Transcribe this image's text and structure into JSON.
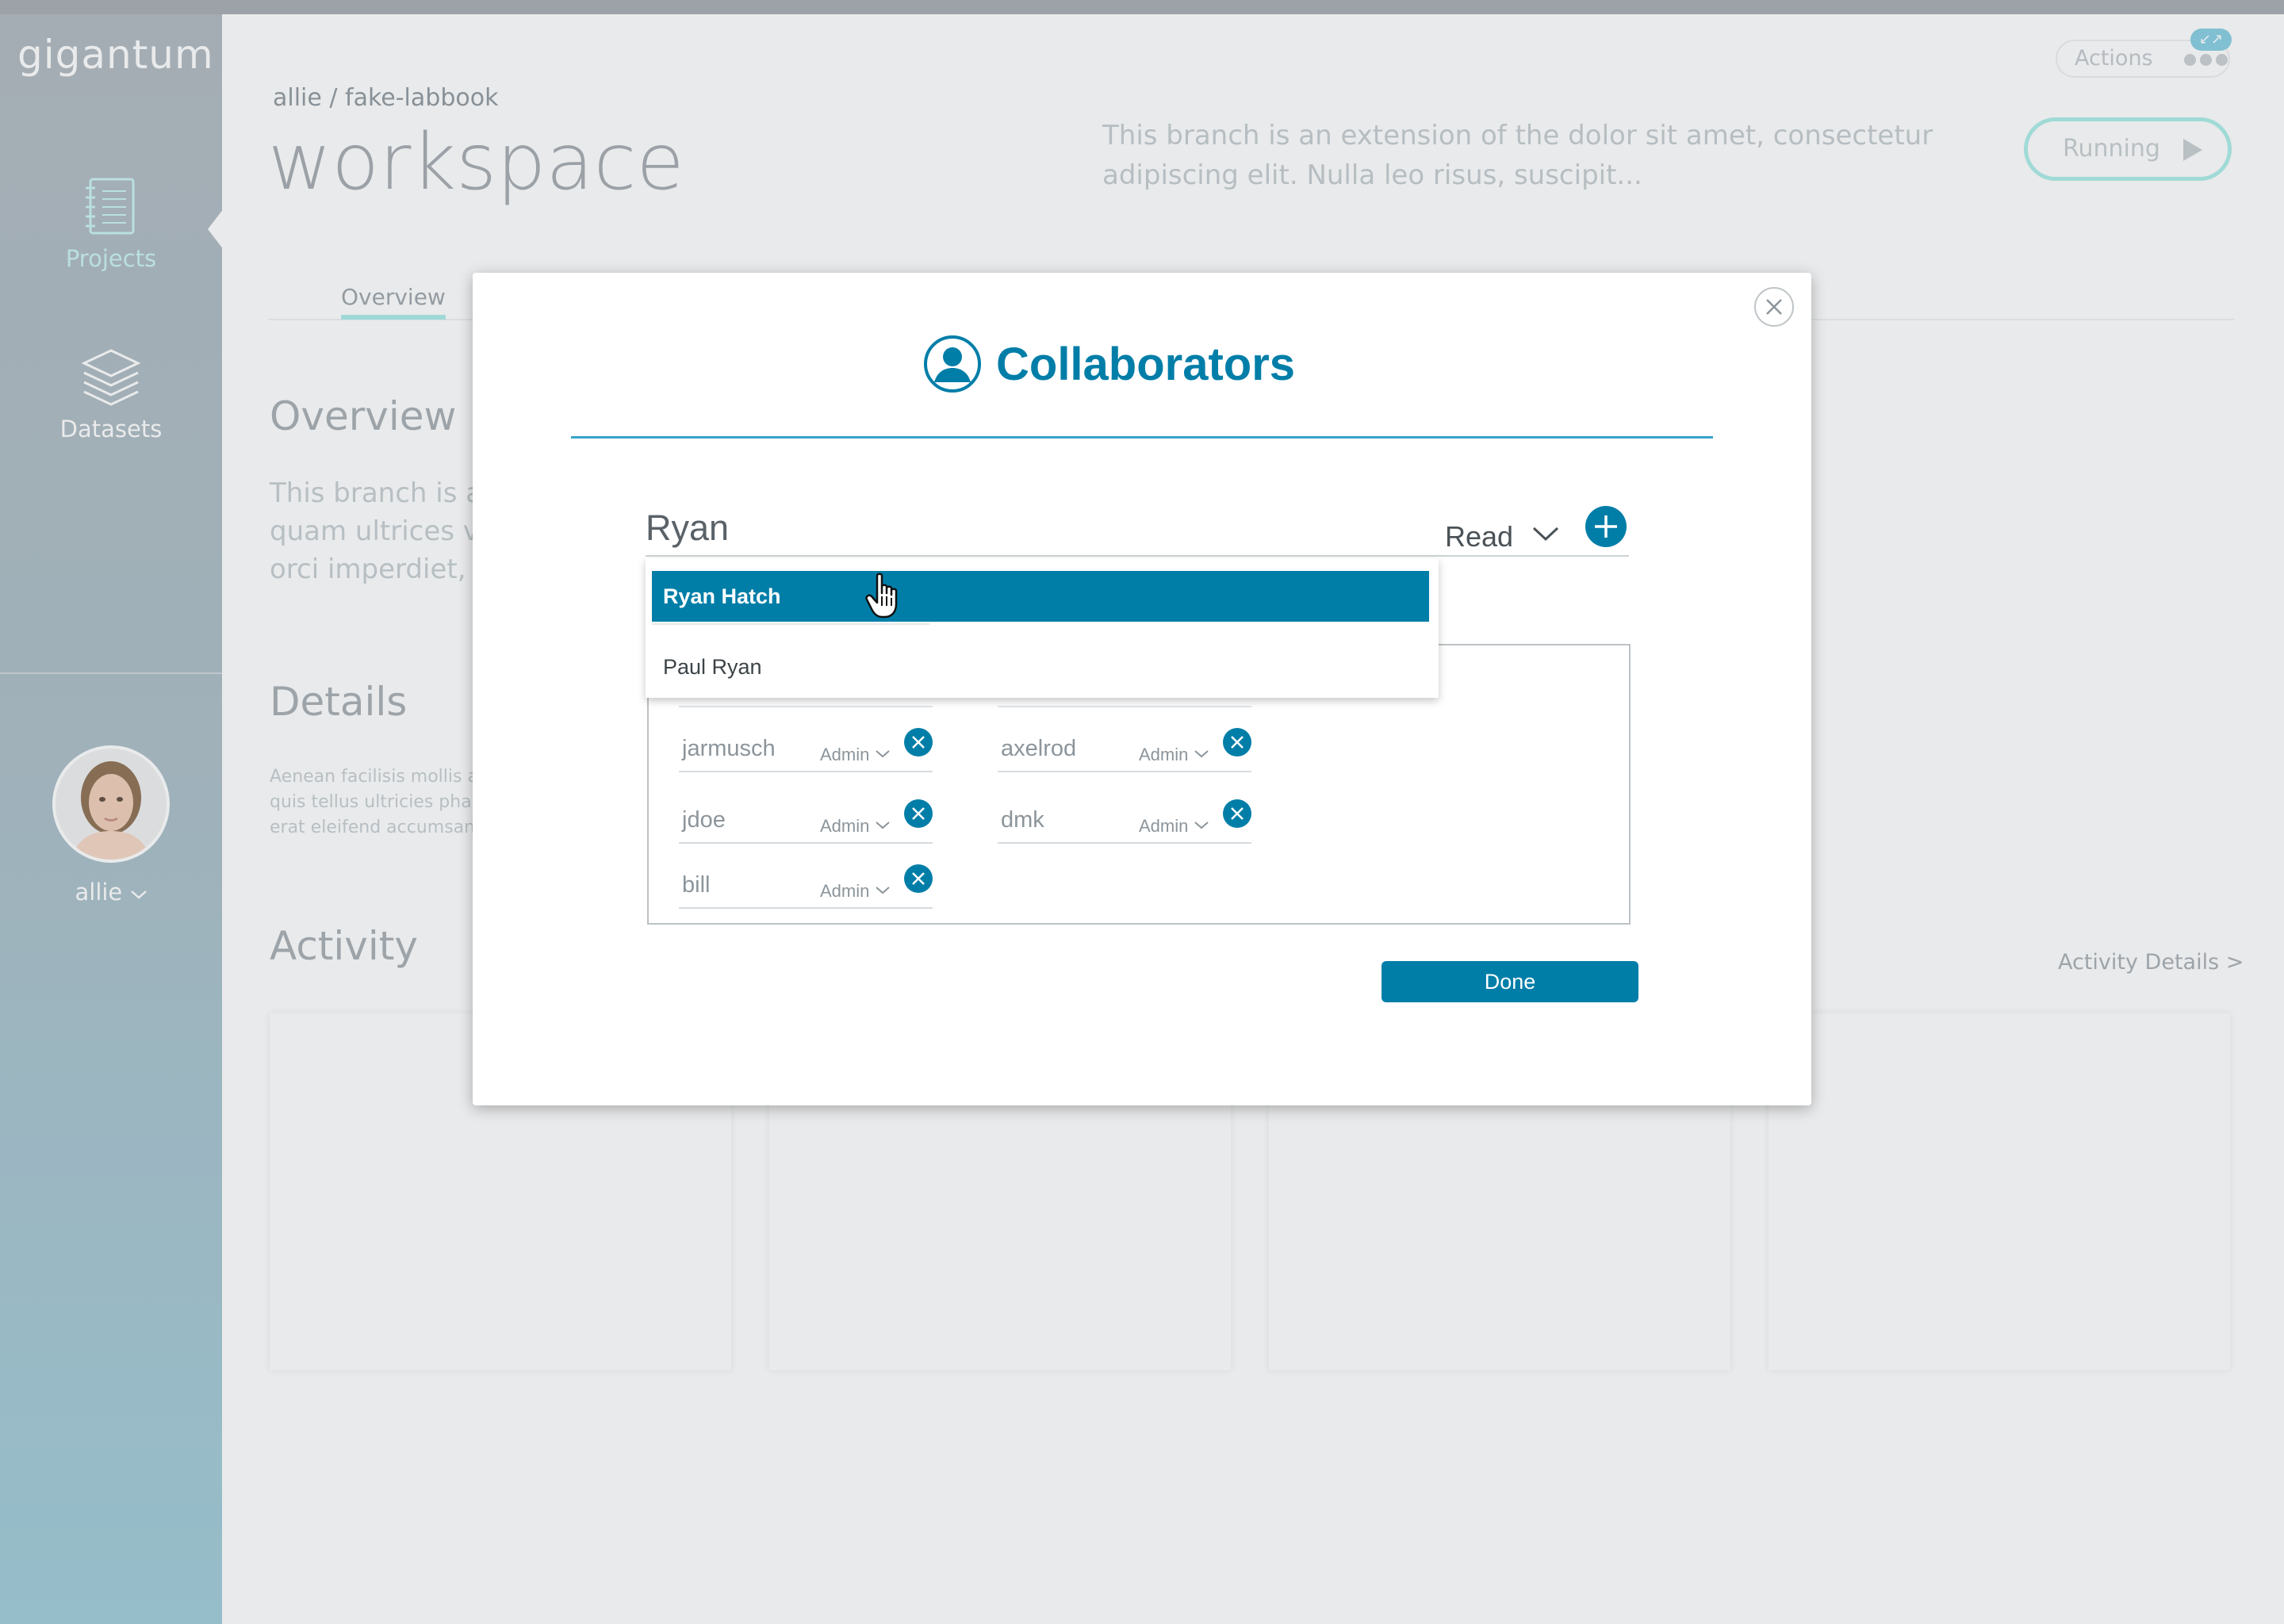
{
  "app": {
    "logo": "gigantum"
  },
  "sidebar": {
    "items": [
      {
        "label": "Projects",
        "icon": "notebook-icon",
        "active": true
      },
      {
        "label": "Datasets",
        "icon": "layers-icon",
        "active": false
      }
    ],
    "user": {
      "name": "allie"
    }
  },
  "header": {
    "breadcrumb": "allie / fake-labbook",
    "title": "workspace",
    "description": "This branch is an extension of the dolor sit amet, consectetur adipiscing elit. Nulla leo risus, suscipit...",
    "actions_label": "Actions",
    "running_label": "Running"
  },
  "tabs": {
    "overview": "Overview"
  },
  "sections": {
    "overview": {
      "title": "Overview",
      "text_lines": [
        "This branch is a",
        "quam ultrices vi",
        "orci imperdiet, a"
      ]
    },
    "details": {
      "title": "Details",
      "text_lines": [
        "Aenean facilisis mollis a",
        "quis tellus ultricies phar",
        "erat eleifend accumsan."
      ]
    },
    "activity": {
      "title": "Activity",
      "link": "Activity Details >"
    }
  },
  "modal": {
    "title": "Collaborators",
    "search_value": "Ryan",
    "permission": "Read",
    "suggestions": [
      "Ryan Hatch",
      "Paul Ryan"
    ],
    "highlighted_suggestion": "Ryan Hatch",
    "collaborators": [
      {
        "name": "jarmusch",
        "role": "Admin"
      },
      {
        "name": "axelrod",
        "role": "Admin"
      },
      {
        "name": "jdoe",
        "role": "Admin"
      },
      {
        "name": "dmk",
        "role": "Admin"
      },
      {
        "name": "bill",
        "role": "Admin"
      }
    ],
    "done_label": "Done"
  },
  "colors": {
    "accent": "#007ea8",
    "running_border": "#a8ece8"
  }
}
